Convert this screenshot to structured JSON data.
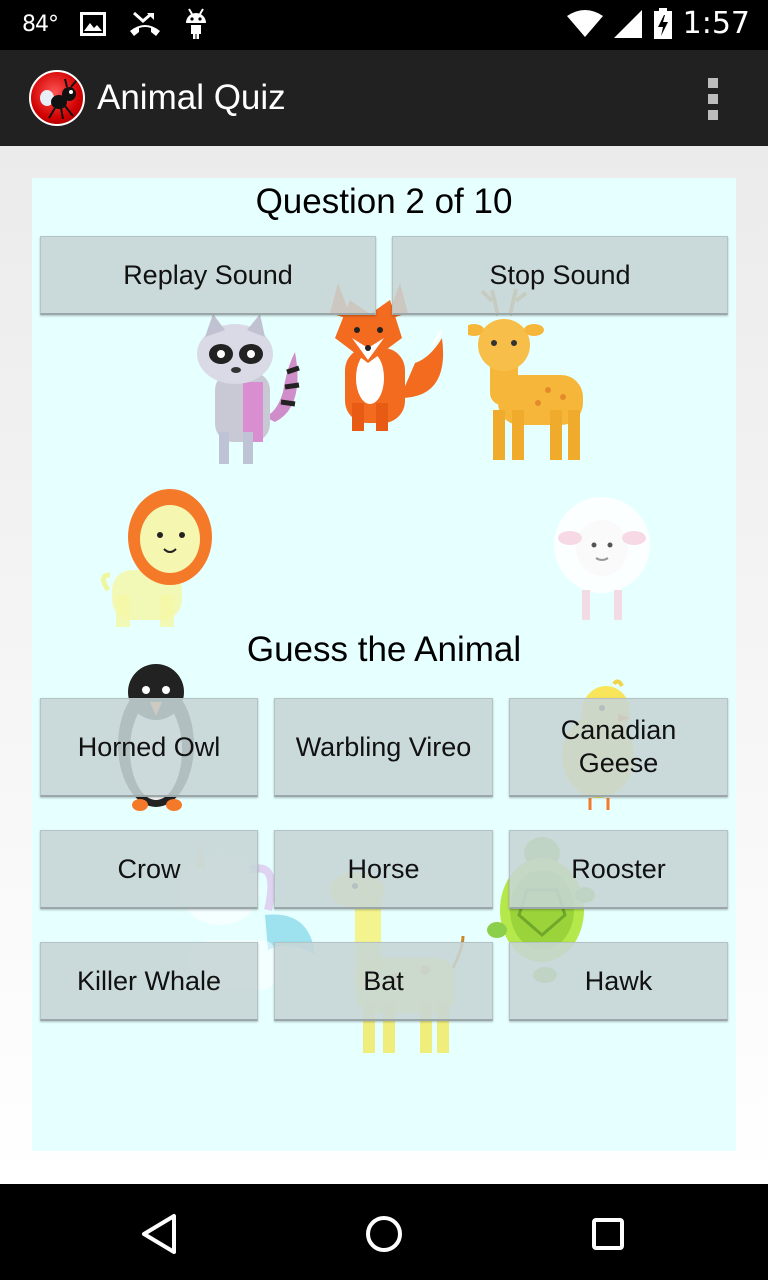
{
  "status_bar": {
    "temperature": "84°",
    "time": "1:57",
    "icons": [
      "image-icon",
      "missed-call-icon",
      "android-icon",
      "wifi-icon",
      "signal-icon",
      "battery-charging-icon"
    ]
  },
  "action_bar": {
    "title": "Animal Quiz",
    "logo_icon": "ant-logo-icon",
    "menu_icon": "overflow-menu-icon"
  },
  "quiz": {
    "question_label": "Question 2 of 10",
    "replay_label": "Replay Sound",
    "stop_label": "Stop Sound",
    "guess_label": "Guess the Animal",
    "answers": [
      "Horned Owl",
      "Warbling Vireo",
      "Canadian\nGeese",
      "Crow",
      "Horse",
      "Rooster",
      "Killer Whale",
      "Bat",
      "Hawk"
    ]
  },
  "background_art": [
    "raccoon",
    "fox",
    "deer",
    "lion",
    "sheep",
    "penguin",
    "chick",
    "unicorn",
    "giraffe",
    "turtle"
  ],
  "nav_bar": {
    "icons": [
      "back-icon",
      "home-icon",
      "recents-icon"
    ]
  },
  "colors": {
    "panel": "#e6ffff",
    "button": "#c6d5d6",
    "action_bar": "#212121"
  }
}
